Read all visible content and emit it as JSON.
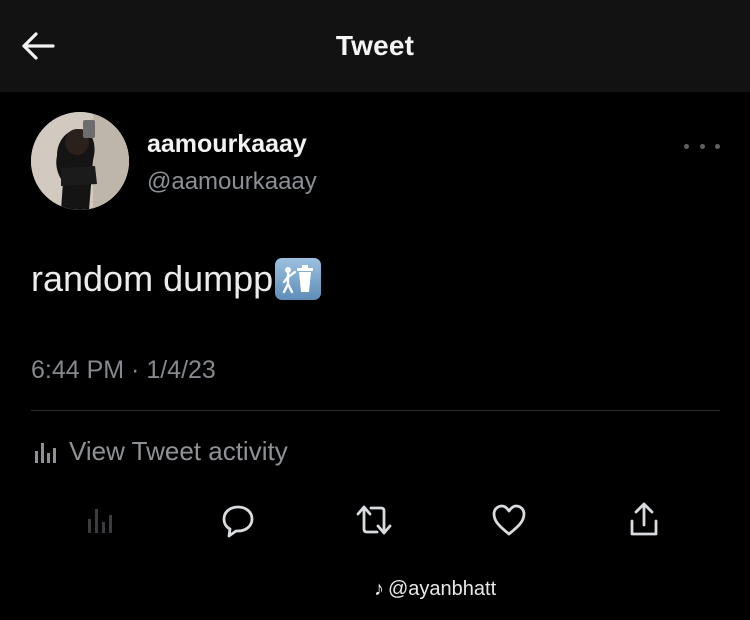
{
  "header": {
    "title": "Tweet",
    "back_icon": "arrow-left-icon"
  },
  "tweet": {
    "display_name": "aamourkaaay",
    "handle": "@aamourkaaay",
    "text": "random dumpp",
    "emoji": "litter-bin-icon",
    "timestamp": "6:44 PM · 1/4/23",
    "more_icon": "more-dots-icon"
  },
  "activity": {
    "label": "View Tweet activity",
    "icon": "bar-chart-icon"
  },
  "actions": [
    {
      "name": "analytics",
      "icon": "bar-chart-icon"
    },
    {
      "name": "reply",
      "icon": "comment-icon"
    },
    {
      "name": "retweet",
      "icon": "retweet-icon"
    },
    {
      "name": "like",
      "icon": "heart-icon"
    },
    {
      "name": "share",
      "icon": "share-icon"
    }
  ],
  "watermark": {
    "text": "@ayanbhatt"
  },
  "colors": {
    "background": "#000000",
    "header_bg": "#121212",
    "primary_text": "#e7e9ea",
    "secondary_text": "#8b9096"
  }
}
